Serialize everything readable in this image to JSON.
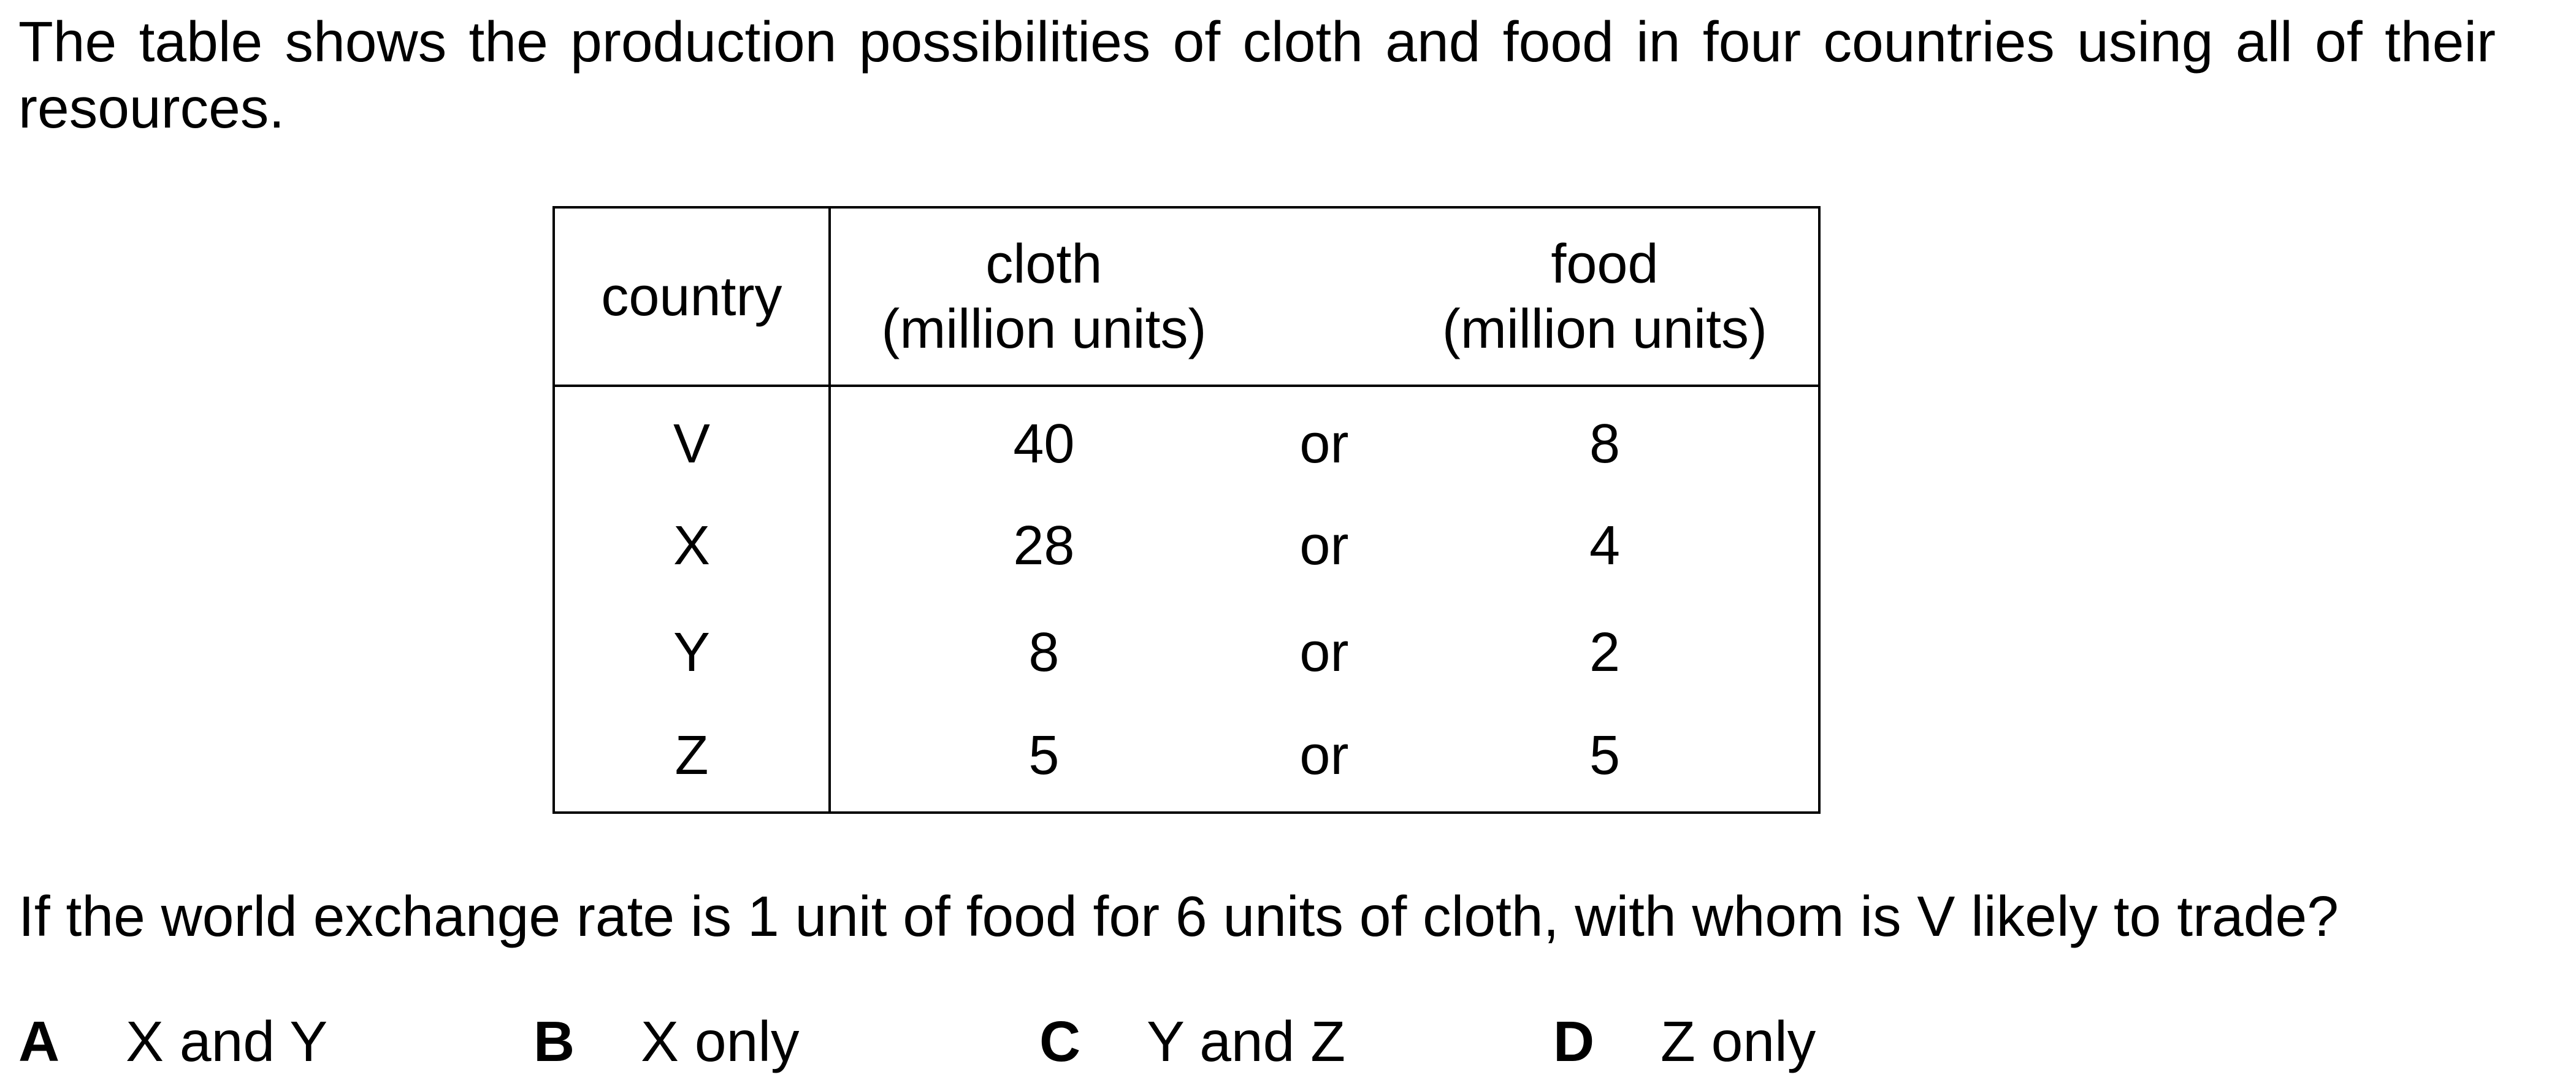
{
  "intro": {
    "line1": "The table shows the production possibilities of cloth and food in four countries using all of their",
    "line2": "resources."
  },
  "table": {
    "headers": {
      "country": "country",
      "cloth_name": "cloth",
      "cloth_unit": "(million units)",
      "food_name": "food",
      "food_unit": "(million units)"
    },
    "rows": [
      {
        "country": "V",
        "cloth": "40",
        "or": "or",
        "food": "8"
      },
      {
        "country": "X",
        "cloth": "28",
        "or": "or",
        "food": "4"
      },
      {
        "country": "Y",
        "cloth": "8",
        "or": "or",
        "food": "2"
      },
      {
        "country": "Z",
        "cloth": "5",
        "or": "or",
        "food": "5"
      }
    ]
  },
  "question": "If the world exchange rate is 1 unit of food for 6 units of cloth, with whom is V likely to trade?",
  "options": [
    {
      "letter": "A",
      "text": "X and Y"
    },
    {
      "letter": "B",
      "text": "X only"
    },
    {
      "letter": "C",
      "text": "Y and Z"
    },
    {
      "letter": "D",
      "text": "Z only"
    }
  ]
}
